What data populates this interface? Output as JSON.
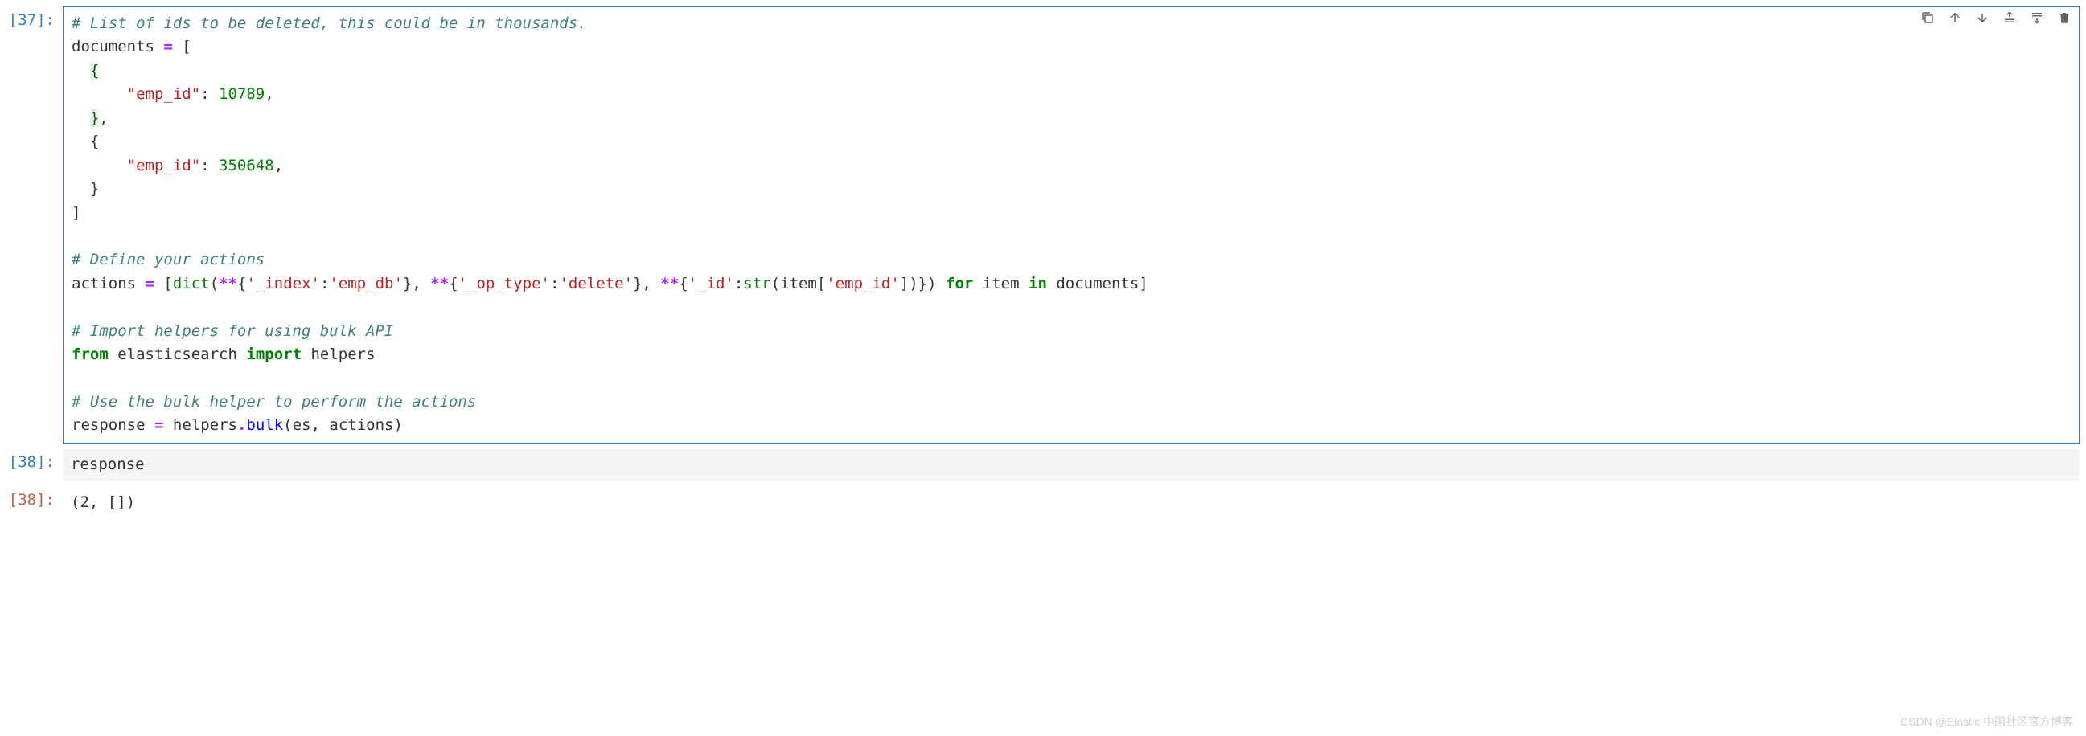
{
  "cells": {
    "cell1": {
      "prompt": "[37]:",
      "comment1": "# List of ids to be deleted, this could be in thousands.",
      "documents_var": "documents",
      "emp_id_key": "\"emp_id\"",
      "emp_id_val1": "10789",
      "emp_id_val2": "350648",
      "comment2": "# Define your actions",
      "actions_var": "actions",
      "dict_fn": "dict",
      "index_key": "'_index'",
      "index_val": "'emp_db'",
      "optype_key": "'_op_type'",
      "optype_val": "'delete'",
      "id_key": "'_id'",
      "str_fn": "str",
      "item_var": "item",
      "empid_lookup": "'emp_id'",
      "for_kw": "for",
      "in_kw": "in",
      "documents_ref": "documents",
      "comment3": "# Import helpers for using bulk API",
      "from_kw": "from",
      "es_module": "elasticsearch",
      "import_kw": "import",
      "helpers_name": "helpers",
      "comment4": "# Use the bulk helper to perform the actions",
      "response_var": "response",
      "helpers_ref": "helpers",
      "bulk_fn": "bulk",
      "es_arg": "es",
      "actions_arg": "actions"
    },
    "cell2": {
      "prompt": "[38]:",
      "code": "response"
    },
    "cell3": {
      "prompt": "[38]:",
      "output": "(2, [])"
    }
  },
  "watermark": "CSDN @Elastic 中国社区官方博客"
}
